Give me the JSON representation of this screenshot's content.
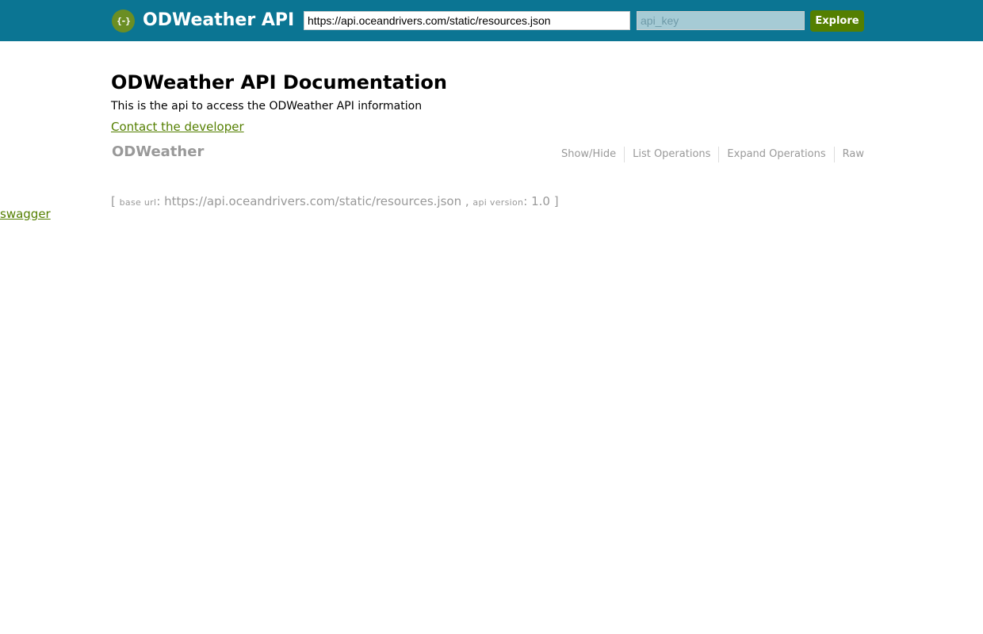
{
  "header": {
    "logo_glyph": "{-}",
    "logo_icon": "swagger-logo-icon",
    "title": "ODWeather API",
    "url_value": "https://api.oceandrivers.com/static/resources.json",
    "api_key_placeholder": "api_key",
    "explore_label": "Explore",
    "colors": {
      "bar": "#0b7593",
      "button": "#547f00"
    }
  },
  "info": {
    "title": "ODWeather API Documentation",
    "description": "This is the api to access the ODWeather API information",
    "contact_label": "Contact the developer"
  },
  "resource": {
    "name": "ODWeather",
    "operations": [
      "Show/Hide",
      "List Operations",
      "Expand Operations",
      "Raw"
    ]
  },
  "footer": {
    "open_bracket": "[",
    "base_url_label": "base url",
    "base_url": "https://api.oceandrivers.com/static/resources.json",
    "separator": ",",
    "api_version_label": "api version",
    "api_version": "1.0",
    "close_bracket": "]"
  },
  "swagger_link": "swagger"
}
